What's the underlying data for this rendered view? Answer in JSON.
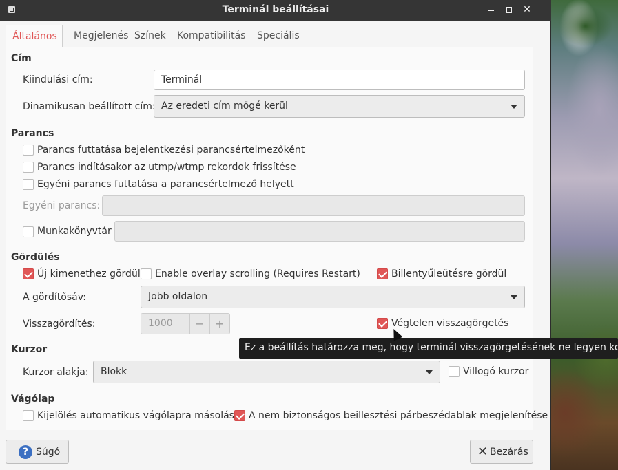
{
  "window": {
    "title": "Terminál beállításai"
  },
  "tabs": [
    {
      "label": "Általános",
      "active": true
    },
    {
      "label": "Megjelenés",
      "active": false
    },
    {
      "label": "Színek",
      "active": false
    },
    {
      "label": "Kompatibilitás",
      "active": false
    },
    {
      "label": "Speciális",
      "active": false
    }
  ],
  "title_section": {
    "heading": "Cím",
    "initial_title_label": "Kiindulási cím:",
    "initial_title_value": "Terminál",
    "dynamic_title_label": "Dinamikusan beállított cím:",
    "dynamic_title_value": "Az eredeti cím mögé kerül"
  },
  "command_section": {
    "heading": "Parancs",
    "options": [
      {
        "label": "Parancs futtatása bejelentkezési parancsértelmezőként",
        "checked": false
      },
      {
        "label": "Parancs indításakor az utmp/wtmp rekordok frissítése",
        "checked": false
      },
      {
        "label": "Egyéni parancs futtatása a parancsértelmező helyett",
        "checked": false
      }
    ],
    "custom_command_label": "Egyéni parancs:",
    "custom_command_value": "",
    "working_dir_label": "Munkakönyvtár",
    "working_dir_checked": false,
    "working_dir_value": ""
  },
  "scroll_section": {
    "heading": "Gördülés",
    "scroll_on_output_label": "Új kimenethez gördül",
    "scroll_on_output_checked": true,
    "overlay_label": "Enable overlay scrolling (Requires Restart)",
    "overlay_checked": false,
    "scroll_on_key_label": "Billentyűleütésre gördül",
    "scroll_on_key_checked": true,
    "scrollbar_label": "A gördítősáv:",
    "scrollbar_value": "Jobb oldalon",
    "scrollback_label": "Visszagördítés:",
    "scrollback_value": "1000",
    "spin_minus": "−",
    "spin_plus": "+",
    "unlimited_label": "Végtelen visszagörgetés",
    "unlimited_checked": true,
    "tooltip": "Ez a beállítás határozza meg, hogy terminál visszagörgetésének ne legyen korlátja."
  },
  "cursor_section": {
    "heading": "Kurzor",
    "shape_label": "Kurzor alakja:",
    "shape_value": "Blokk",
    "blink_label": "Villogó kurzor",
    "blink_checked": false
  },
  "clipboard_section": {
    "heading": "Vágólap",
    "autocopy_label": "Kijelölés automatikus vágólapra másolása",
    "autocopy_checked": false,
    "unsafe_paste_label": "A nem biztonságos beillesztési párbeszédablak megjelenítése",
    "unsafe_paste_checked": true
  },
  "footer": {
    "help_label": "Súgó",
    "close_label": "Bezárás"
  },
  "icons": {
    "help": "help-icon",
    "close": "close-icon",
    "dropdown": "chevron-down-icon"
  },
  "colors": {
    "accent": "#e05656",
    "titlebar": "#353535",
    "help_icon": "#3b6fc2"
  }
}
